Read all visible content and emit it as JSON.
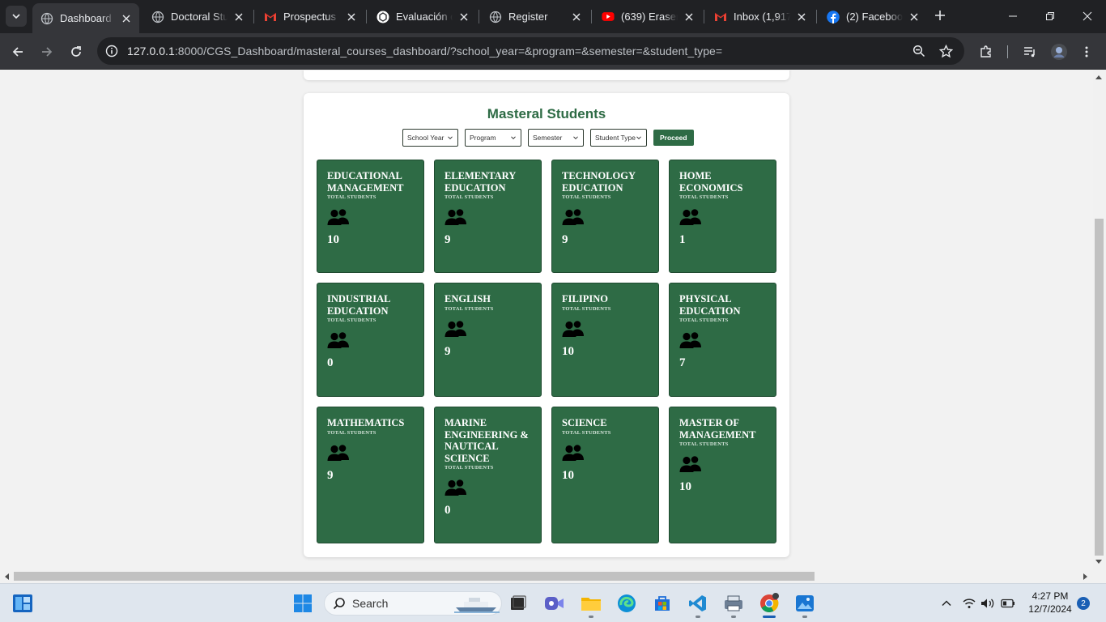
{
  "browser": {
    "tabs": [
      {
        "title": "Dashboard P",
        "icon": "globe-icon",
        "active": true
      },
      {
        "title": "Doctoral Stu",
        "icon": "globe-icon",
        "active": false
      },
      {
        "title": "Prospectus S",
        "icon": "gmail-icon",
        "active": false
      },
      {
        "title": "Evaluación d",
        "icon": "chatgpt-icon",
        "active": false
      },
      {
        "title": "Register",
        "icon": "globe-icon",
        "active": false
      },
      {
        "title": "(639) Eraser",
        "icon": "youtube-icon",
        "active": false
      },
      {
        "title": "Inbox (1,917)",
        "icon": "gmail-icon",
        "active": false
      },
      {
        "title": "(2) Facebook",
        "icon": "facebook-icon",
        "active": false
      }
    ],
    "url_host": "127.0.0.1",
    "url_rest": ":8000/CGS_Dashboard/masteral_courses_dashboard/?school_year=&program=&semester=&student_type="
  },
  "page": {
    "title": "Masteral Students",
    "filters": [
      {
        "name": "school-year",
        "label": "School Year"
      },
      {
        "name": "program",
        "label": "Program"
      },
      {
        "name": "semester",
        "label": "Semester"
      },
      {
        "name": "student-type",
        "label": "Student Type"
      }
    ],
    "proceed_label": "Proceed",
    "total_label": "TOTAL STUDENTS",
    "courses": [
      {
        "name": "EDUCATIONAL MANAGEMENT",
        "count": "10"
      },
      {
        "name": "ELEMENTARY EDUCATION",
        "count": "9"
      },
      {
        "name": "TECHNOLOGY EDUCATION",
        "count": "9"
      },
      {
        "name": "HOME ECONOMICS",
        "count": "1"
      },
      {
        "name": "INDUSTRIAL EDUCATION",
        "count": "0"
      },
      {
        "name": "ENGLISH",
        "count": "9"
      },
      {
        "name": "FILIPINO",
        "count": "10"
      },
      {
        "name": "PHYSICAL EDUCATION",
        "count": "7"
      },
      {
        "name": "MATHEMATICS",
        "count": "9"
      },
      {
        "name": "MARINE ENGINEERING & NAUTICAL SCIENCE",
        "count": "0"
      },
      {
        "name": "SCIENCE",
        "count": "10"
      },
      {
        "name": "MASTER OF MANAGEMENT",
        "count": "10"
      }
    ]
  },
  "taskbar": {
    "search_label": "Search",
    "time": "4:27 PM",
    "date": "12/7/2024",
    "notifications": "2"
  },
  "colors": {
    "accent": "#2e6b45",
    "chrome_dark": "#202124",
    "chrome_toolbar": "#35363a"
  }
}
